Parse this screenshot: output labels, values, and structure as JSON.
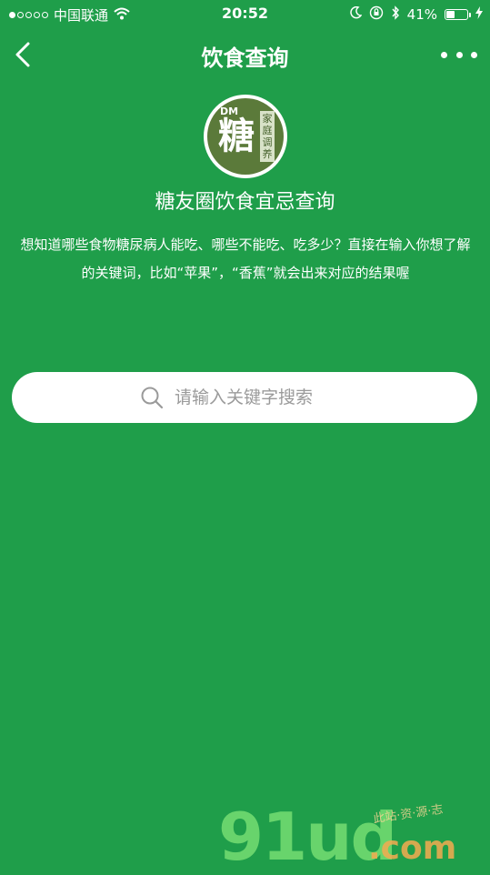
{
  "status_bar": {
    "carrier": "中国联通",
    "time": "20:52",
    "battery": "41%",
    "battery_level": 0.41
  },
  "nav": {
    "title": "饮食查询"
  },
  "logo": {
    "dm": "DM",
    "char": "糖",
    "tag": "家庭调养"
  },
  "subtitle": "糖友圈饮食宜忌查询",
  "description": "想知道哪些食物糖尿病人能吃、哪些不能吃、吃多少？直接在输入你想了解的关键词，比如“苹果”，“香蕉”就会出来对应的结果喔",
  "search": {
    "placeholder": "请输入关键字搜索"
  },
  "watermark": {
    "main": "91ud",
    "domain": ".com",
    "tag": "此站·资·源·志"
  },
  "colors": {
    "background": "#1f9e4a",
    "search_bg": "#ffffff",
    "placeholder": "#9a9a9a"
  },
  "icons": {
    "back": "chevron-left-icon",
    "more": "more-dots-icon",
    "search": "search-icon",
    "wifi": "wifi-icon",
    "moon": "moon-icon",
    "lock": "rotation-lock-icon",
    "bluetooth": "bluetooth-icon",
    "charging": "bolt-icon"
  }
}
